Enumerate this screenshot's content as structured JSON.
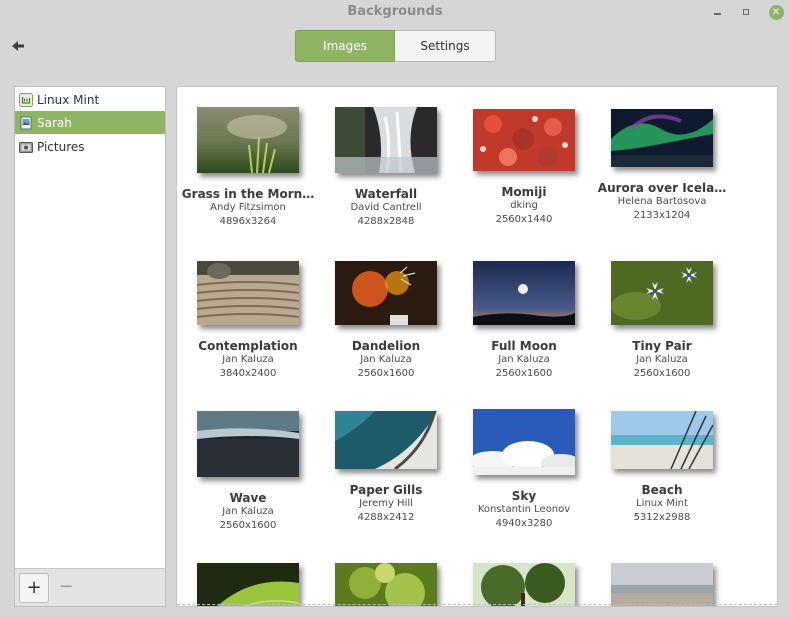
{
  "window": {
    "title": "Backgrounds",
    "accent": "#8fb464"
  },
  "header": {
    "tabs": [
      {
        "label": "Images",
        "selected": true
      },
      {
        "label": "Settings",
        "selected": false
      }
    ],
    "back_icon": "back-arrow-icon"
  },
  "sidebar": {
    "items": [
      {
        "label": "Linux Mint",
        "icon": "mint-logo-icon",
        "selected": false
      },
      {
        "label": "Sarah",
        "icon": "folder-icon",
        "selected": true
      },
      {
        "label": "Pictures",
        "icon": "pictures-folder-icon",
        "selected": false
      }
    ],
    "add_label": "+",
    "remove_label": "−"
  },
  "gallery": {
    "items": [
      {
        "name": "Grass in the Morn…",
        "author": "Andy Fitzsimon",
        "size": "4896x3264"
      },
      {
        "name": "Waterfall",
        "author": "David Cantrell",
        "size": "4288x2848"
      },
      {
        "name": "Momiji",
        "author": "dking",
        "size": "2560x1440"
      },
      {
        "name": "Aurora over Icela…",
        "author": "Helena Bartosova",
        "size": "2133x1204"
      },
      {
        "name": "Contemplation",
        "author": "Jan Kaluza",
        "size": "3840x2400"
      },
      {
        "name": "Dandelion",
        "author": "Jan Kaluza",
        "size": "2560x1600"
      },
      {
        "name": "Full Moon",
        "author": "Jan Kaluza",
        "size": "2560x1600"
      },
      {
        "name": "Tiny Pair",
        "author": "Jan Kaluza",
        "size": "2560x1600"
      },
      {
        "name": "Wave",
        "author": "Jan Kaluza",
        "size": "2560x1600"
      },
      {
        "name": "Paper Gills",
        "author": "Jeremy Hill",
        "size": "4288x2412"
      },
      {
        "name": "Sky",
        "author": "Konstantin Leonov",
        "size": "4940x3280"
      },
      {
        "name": "Beach",
        "author": "Linux Mint",
        "size": "5312x2988"
      }
    ]
  }
}
